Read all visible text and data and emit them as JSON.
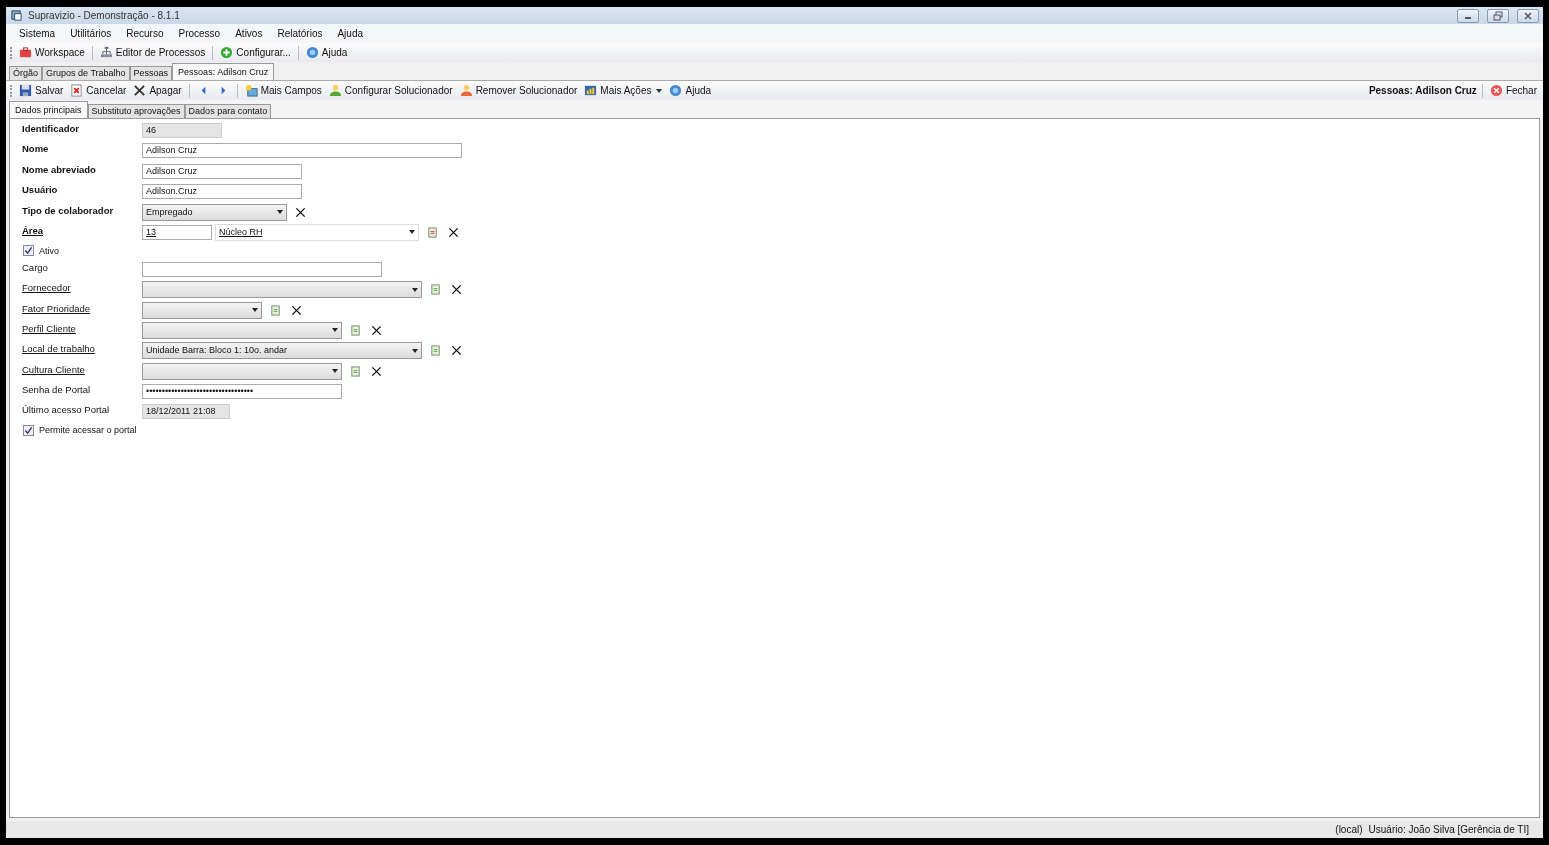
{
  "window": {
    "title": "Supravizio - Demonstração - 8.1.1"
  },
  "menu": [
    "Sistema",
    "Utilitários",
    "Recurso",
    "Processo",
    "Ativos",
    "Relatórios",
    "Ajuda"
  ],
  "toolbar": [
    {
      "kind": "workspace",
      "label": "Workspace"
    },
    {
      "kind": "editor",
      "label": "Editor de Processos"
    },
    {
      "kind": "add",
      "label": "Configurar..."
    },
    {
      "kind": "help",
      "label": "Ajuda"
    }
  ],
  "tabs": [
    {
      "label": "Órgão",
      "selected": false
    },
    {
      "label": "Grupos de Trabalho",
      "selected": false
    },
    {
      "label": "Pessoas",
      "selected": false
    },
    {
      "label": "Pessoas: Adilson Cruz",
      "selected": true
    }
  ],
  "actions": [
    {
      "kind": "save",
      "label": "Salvar"
    },
    {
      "kind": "cancel",
      "label": "Cancelar"
    },
    {
      "kind": "delete",
      "label": "Apagar"
    },
    {
      "kind": "prev"
    },
    {
      "kind": "next"
    },
    {
      "kind": "fields",
      "label": "Mais Campos"
    },
    {
      "kind": "person",
      "label": "Configurar Solucionador"
    },
    {
      "kind": "person-remove",
      "label": "Remover Solucionador"
    },
    {
      "kind": "more",
      "label": "Mais Ações"
    },
    {
      "kind": "help",
      "label": "Ajuda"
    }
  ],
  "record_title": "Pessoas: Adilson Cruz",
  "close_label": "Fechar",
  "subtabs": [
    {
      "label": "Dados principais",
      "selected": true
    },
    {
      "label": "Substituto aprovações",
      "selected": false
    },
    {
      "label": "Dados para contato",
      "selected": false
    }
  ],
  "fields": [
    {
      "kind": "text",
      "label": "Identificador",
      "bold": true,
      "link": false,
      "value": "46",
      "readonly": true
    },
    {
      "kind": "text",
      "label": "Nome",
      "bold": true,
      "link": false,
      "value": "Adilson Cruz",
      "readonly": false
    },
    {
      "kind": "text",
      "label": "Nome abreviado",
      "bold": true,
      "link": false,
      "value": "Adilson Cruz",
      "readonly": false
    },
    {
      "kind": "text",
      "label": "Usuário",
      "bold": true,
      "link": false,
      "value": "Adilson.Cruz",
      "readonly": false
    },
    {
      "kind": "combo",
      "label": "Tipo de colaborador",
      "bold": true,
      "link": false,
      "value": "Empregado",
      "lookup": false,
      "clear": true
    },
    {
      "kind": "area",
      "label": "Área",
      "bold": true,
      "link": true,
      "code": "13",
      "value": "Núcleo RH",
      "lookup": true,
      "clear": true
    },
    {
      "kind": "check",
      "label": "Ativo",
      "checked": true
    },
    {
      "kind": "text",
      "label": "Cargo",
      "bold": false,
      "link": false,
      "readonly": false
    },
    {
      "kind": "combo",
      "label": "Fornecedor",
      "bold": false,
      "link": true,
      "lookup": true,
      "clear": true
    },
    {
      "kind": "combo",
      "label": "Fator Prioridade",
      "bold": false,
      "link": true,
      "lookup": true,
      "clear": true
    },
    {
      "kind": "combo",
      "label": "Perfil Cliente",
      "bold": false,
      "link": true,
      "lookup": true,
      "clear": true
    },
    {
      "kind": "combo",
      "label": "Local de trabalho",
      "bold": false,
      "link": true,
      "value": "Unidade Barra: Bloco 1: 10o. andar",
      "lookup": true,
      "clear": true
    },
    {
      "kind": "combo",
      "label": "Cultura Cliente",
      "bold": false,
      "link": true,
      "lookup": true,
      "clear": true
    },
    {
      "kind": "text",
      "label": "Senha de Portal",
      "bold": false,
      "link": false,
      "value": "••••••••••••••••••••••••••••••••••",
      "readonly": false
    },
    {
      "kind": "text",
      "label": "Último acesso Portal",
      "bold": false,
      "link": false,
      "value": "18/12/2011 21:08",
      "readonly": true
    },
    {
      "kind": "check",
      "label": "Permite acessar o portal",
      "checked": true
    }
  ],
  "status_bar": [
    "(local)",
    "Usuário: João Silva [Gerência de TI]"
  ]
}
